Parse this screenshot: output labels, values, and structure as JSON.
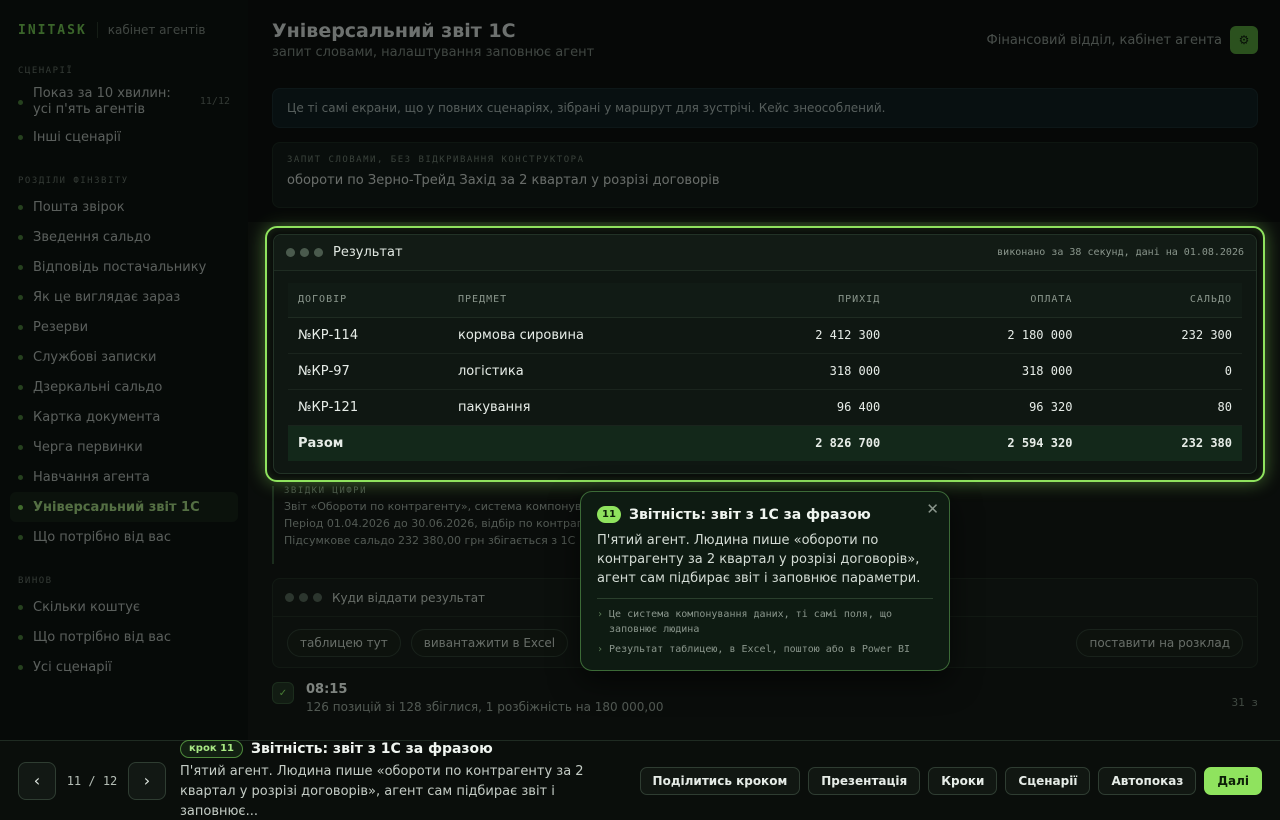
{
  "brand": {
    "name": "INITASK",
    "subtitle": "кабінет агентів"
  },
  "sidebar": {
    "section_scenarios": "СЦЕНАРІЇ",
    "scenarios": [
      {
        "label": "Показ за 10 хвилин: усі п'ять агентів",
        "count": "11/12"
      },
      {
        "label": "Інші сценарії"
      }
    ],
    "section_fin": "РОЗДІЛИ ФІНЗВІТУ",
    "fin_items": [
      "Пошта звірок",
      "Зведення сальдо",
      "Відповідь постачальнику",
      "Як це виглядає зараз",
      "Резерви",
      "Службові записки",
      "Дзеркальні сальдо",
      "Картка документа",
      "Черга первинки",
      "Навчання агента",
      "Універсальний звіт 1С",
      "Що потрібно від вас"
    ],
    "section_results": "ВИНОВ",
    "result_items": [
      "Скільки коштує",
      "Що потрібно від вас",
      "Усі сценарії"
    ]
  },
  "header": {
    "title": "Універсальний звіт 1С",
    "subtitle": "запит словами, налаштування заповнює агент",
    "dept": "Фінансовий відділ, кабінет агента",
    "avatar_icon": "⚙"
  },
  "info_bar": "Це ті самі екрани, що у повних сценаріях, зібрані у маршрут для зустрічі. Кейс знеособлений.",
  "query": {
    "label": "ЗАПИТ СЛОВАМИ, БЕЗ ВІДКРИВАННЯ КОНСТРУКТОРА",
    "text": "обороти по Зерно-Трейд Захід за 2 квартал у розрізі договорів"
  },
  "result": {
    "title": "Результат",
    "meta": "виконано за 38 секунд, дані на 01.08.2026",
    "columns": [
      "ДОГОВІР",
      "ПРЕДМЕТ",
      "ПРИХІД",
      "ОПЛАТА",
      "САЛЬДО"
    ],
    "rows": [
      [
        "№КР-114",
        "кормова сировина",
        "2 412 300",
        "2 180 000",
        "232 300"
      ],
      [
        "№КР-97",
        "логістика",
        "318 000",
        "318 000",
        "0"
      ],
      [
        "№КР-121",
        "пакування",
        "96 400",
        "96 320",
        "80"
      ]
    ],
    "total": [
      "Разом",
      "",
      "2 826 700",
      "2 594 320",
      "232 380"
    ]
  },
  "source": {
    "label": "ЗВІДКИ ЦИФРИ",
    "lines": [
      "Звіт «Обороти по контрагенту», система компонування",
      "Період 01.04.2026 до 30.06.2026, відбір по контрагенту",
      "Підсумкове сальдо 232 380,00 грн збігається з 1С"
    ]
  },
  "destination": {
    "title": "Куди віддати результат",
    "chips": [
      "таблицею тут",
      "вивантажити в Excel"
    ],
    "chip_right": "поставити на розклад"
  },
  "timeline": {
    "icon": "✓",
    "time": "08:15",
    "desc": "126 позицій зі 128 збіглися, 1 розбіжність на 180 000,00",
    "right": "31 з"
  },
  "popover": {
    "num": "11",
    "title": "Звітність: звіт з 1С за фразою",
    "text": "П'ятий агент. Людина пише «обороти по контрагенту за 2 квартал у розрізі договорів», агент сам підбирає звіт і заповнює параметри.",
    "bullets": [
      "Це система компонування даних, ті самі поля, що заповнює людина",
      "Результат таблицею, в Excel, поштою або в Power BI"
    ]
  },
  "bottom": {
    "pager": "11 / 12",
    "step_badge": "крок 11",
    "step_title": "Звітність: звіт з 1С за фразою",
    "step_desc": "П'ятий агент. Людина пише «обороти по контрагенту за 2 квартал у розрізі договорів», агент сам підбирає звіт і заповнює...",
    "actions": [
      "Поділитись кроком",
      "Презентація",
      "Кроки",
      "Сценарії",
      "Автопоказ"
    ],
    "next": "Далі"
  }
}
